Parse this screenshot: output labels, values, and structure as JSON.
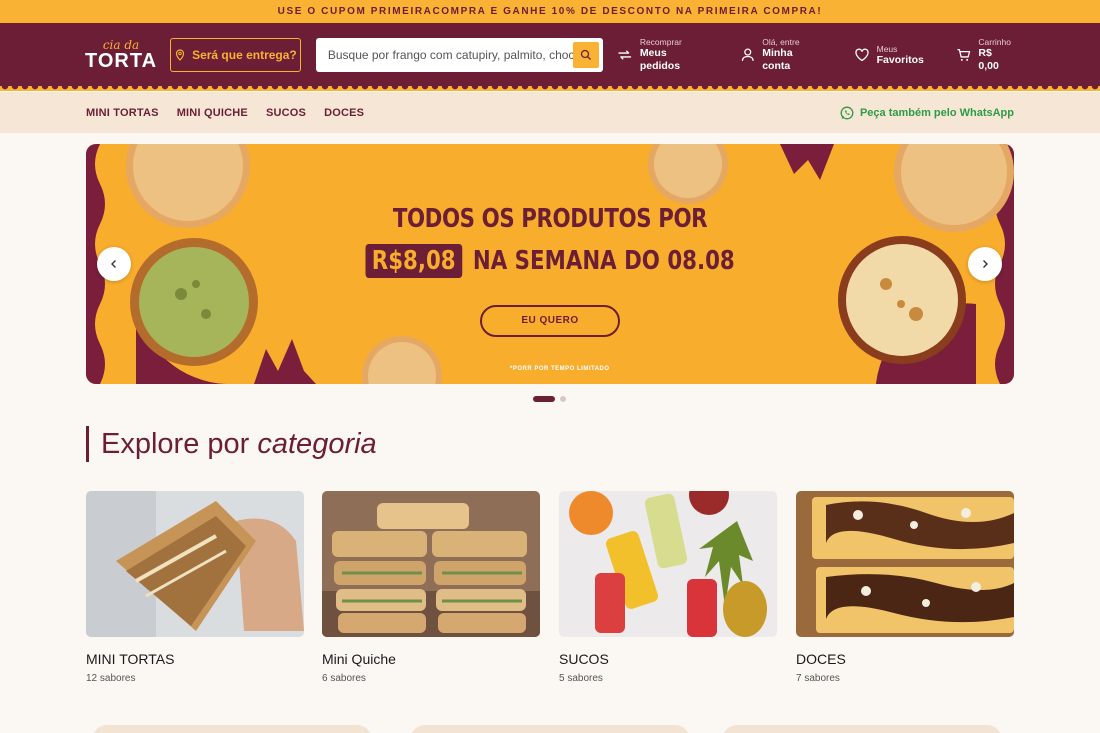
{
  "promo": "USE O CUPOM PRIMEIRACOMPRA E GANHE 10% DE DESCONTO NA PRIMEIRA COMPRA!",
  "logo": {
    "top": "cia da",
    "main": "TORTA"
  },
  "header": {
    "delivery_label": "Será que entrega?",
    "search_placeholder": "Busque por frango com catupiry, palmito, chocolate...",
    "links": [
      {
        "small": "Recomprar",
        "big": "Meus pedidos",
        "icon": "repeat-icon"
      },
      {
        "small": "Olá, entre",
        "big": "Minha conta",
        "icon": "user-icon"
      },
      {
        "small": "Meus",
        "big": "Favoritos",
        "icon": "heart-icon"
      },
      {
        "small": "Carrinho",
        "big": "R$ 0,00",
        "icon": "cart-icon"
      }
    ]
  },
  "nav": {
    "items": [
      "MINI TORTAS",
      "MINI QUICHE",
      "SUCOS",
      "DOCES"
    ],
    "whatsapp": "Peça também pelo WhatsApp"
  },
  "banner": {
    "line1": "TODOS OS PRODUTOS POR",
    "price": "R$8,08",
    "line2": "NA SEMANA DO 08.08",
    "cta": "EU QUERO",
    "fine_print": "*PORR POR TEMPO LIMITADO"
  },
  "section": {
    "title_plain": "Explore por",
    "title_em": "categoria"
  },
  "categories": [
    {
      "name": "MINI TORTAS",
      "count": "12 sabores"
    },
    {
      "name": "Mini Quiche",
      "count": "6 sabores"
    },
    {
      "name": "SUCOS",
      "count": "5 sabores"
    },
    {
      "name": "DOCES",
      "count": "7 sabores"
    }
  ],
  "colors": {
    "brand": "#6b1e35",
    "accent": "#f9b233",
    "whatsapp": "#2e9b45"
  }
}
